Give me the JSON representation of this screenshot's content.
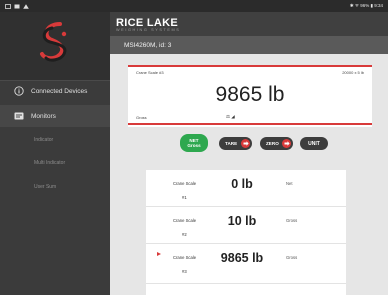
{
  "status_bar": {
    "left_icons": [
      "notification-icon",
      "image-icon",
      "warning-icon"
    ],
    "right_text": "✱ ᯤ 96% ▮ 9:34"
  },
  "brand": {
    "name": "RICE LAKE",
    "tagline": "WEIGHING SYSTEMS"
  },
  "device": {
    "title": "MSI4260M, id: 3"
  },
  "sidebar": {
    "items": [
      {
        "label": "Connected Devices",
        "icon": "info-icon"
      },
      {
        "label": "Monitors",
        "icon": "monitor-icon"
      }
    ],
    "subitems": [
      "Indicator",
      "Multi Indicator",
      "User Sum"
    ]
  },
  "scale": {
    "name": "Crane Scale #3",
    "capacity": "20000 x 5 lb",
    "weight": "9865 lb",
    "mode": "Gross",
    "status_icons": "⚖ ◢"
  },
  "buttons": {
    "net_line1": "NET",
    "net_line2": "Gross",
    "tare": "TARE",
    "zero": "ZERO",
    "unit": "UNIT"
  },
  "scale_list": [
    {
      "name": "Crane Scale",
      "number": "#1",
      "weight": "0 lb",
      "mode": "Net",
      "selected": false
    },
    {
      "name": "Crane Scale",
      "number": "#2",
      "weight": "10 lb",
      "mode": "Gross",
      "selected": false
    },
    {
      "name": "Crane Scale",
      "number": "#3",
      "weight": "9865 lb",
      "mode": "Gross",
      "selected": true
    }
  ],
  "colors": {
    "accent_red": "#d83a3a",
    "net_green": "#2ea84f",
    "sidebar_bg": "#3b3b3b",
    "topbar_bg": "#404040"
  }
}
